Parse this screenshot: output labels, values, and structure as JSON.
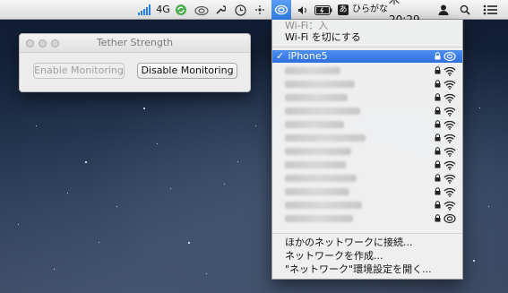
{
  "menubar": {
    "network_type": "4G",
    "input_method_label": "ひらがな",
    "clock": "木 20:29",
    "icons": [
      "signal-bars-icon",
      "sync-icon",
      "creative-cloud-icon",
      "wrench-icon",
      "time-machine-icon",
      "spaces-icon",
      "wifi-icon",
      "volume-icon",
      "battery-icon",
      "input-method-icon",
      "user-icon",
      "spotlight-icon",
      "notification-center-icon"
    ]
  },
  "tether_window": {
    "title": "Tether Strength",
    "enable_button": "Enable Monitoring",
    "disable_button": "Disable Monitoring"
  },
  "wifi_menu": {
    "status": "Wi-Fi：入",
    "toggle": "Wi-Fi を切にする",
    "connected_network": "iPhone5",
    "check_mark": "✓",
    "other_networks_count": 12,
    "actions": [
      "ほかのネットワークに接続...",
      "ネットワークを作成...",
      "\"ネットワーク\"環境設定を開く..."
    ]
  },
  "colors": {
    "menubar": "#e8e8e8",
    "highlight": "#2f6fe0",
    "desktop": "#1a2b44"
  }
}
